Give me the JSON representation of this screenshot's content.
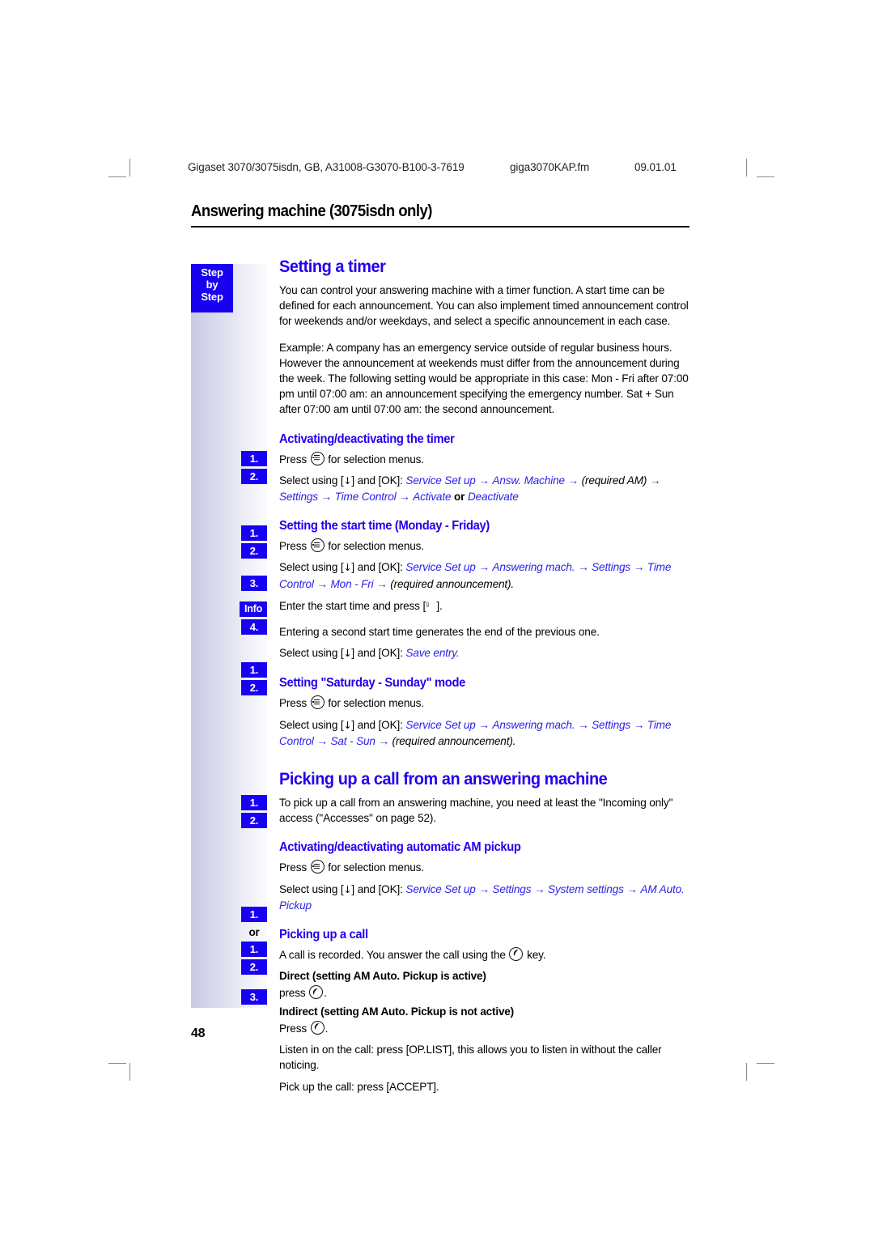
{
  "running_header": {
    "document": "Gigaset 3070/3075isdn, GB, A31008-G3070-B100-3-7619",
    "filename": "giga3070KAP.fm",
    "date": "09.01.01"
  },
  "chapter_title": "Answering machine (3075isdn only)",
  "sidebar": {
    "step_by_step": "Step\nby\nStep",
    "step_by_step_lines": [
      "Step",
      "by",
      "Step"
    ]
  },
  "badges": {
    "one": "1.",
    "two": "2.",
    "three": "3.",
    "four": "4.",
    "info": "Info",
    "or": "or"
  },
  "sections": {
    "setting_a_timer": {
      "heading": "Setting a timer",
      "paragraph_1": "You can control your answering machine with a timer function. A start time can be defined for each announcement. You can also implement timed announcement control for weekends and/or weekdays, and select a specific announcement in each case.",
      "paragraph_2": "Example: A company has an emergency service outside of regular business hours. However the announcement at weekends must differ from the announcement during the week. The following setting would be appropriate in this case: Mon - Fri after 07:00 pm until 07:00 am: an announcement specifying the emergency number. Sat + Sun after 07:00 am until 07:00 am: the second announcement."
    },
    "activating_timer": {
      "heading": "Activating/deactivating the timer",
      "step1_pre": "Press",
      "step1_post": "for selection menus.",
      "step2_pre": "Select using [",
      "step2_mid": "] and [OK]:",
      "step2_path_1": "Service Set up",
      "step2_path_2": "Answ. Machine",
      "step2_path_3": "(required AM)",
      "step2_path_4": "Settings",
      "step2_path_5": "Time Control",
      "step2_path_6": "Activate",
      "step2_or": "or",
      "step2_path_7": "Deactivate"
    },
    "start_time_monfri": {
      "heading": "Setting the start time (Monday - Friday)",
      "step1_pre": "Press",
      "step1_post": "for selection menus.",
      "step2_pre": "Select using [",
      "step2_mid": "] and [OK]:",
      "step2_path_1": "Service Set up",
      "step2_path_2": "Answering mach.",
      "step2_path_3": "Settings",
      "step2_path_4": "Time Control",
      "step2_path_5": "Mon - Fri",
      "step2_path_6": "(required announcement).",
      "step3_pre": "Enter the start time and press [",
      "step3_key": "9",
      "step3_post": "].",
      "info_text": "Entering a second start time generates the end of the previous one.",
      "step4_pre": "Select using [",
      "step4_mid": "] and [OK]:",
      "step4_path": "Save entry."
    },
    "saturday_sunday": {
      "heading": "Setting \"Saturday - Sunday\" mode",
      "step1_pre": "Press",
      "step1_post": "for selection menus.",
      "step2_pre": "Select using [",
      "step2_mid": "] and [OK]:",
      "step2_path_1": "Service Set up",
      "step2_path_2": "Answering mach.",
      "step2_path_3": "Settings",
      "step2_path_4": "Time Control",
      "step2_path_5": "Sat - Sun",
      "step2_path_6": "(required announcement)."
    },
    "picking_up_call": {
      "heading": "Picking up a call from an answering machine",
      "paragraph": "To pick up a call from an answering machine, you need at least the \"Incoming only\" access (\"Accesses\" on page 52)."
    },
    "auto_am_pickup": {
      "heading": "Activating/deactivating automatic AM pickup",
      "step1_pre": "Press",
      "step1_post": "for selection menus.",
      "step2_pre": "Select using [",
      "step2_mid": "] and [OK]:",
      "step2_path_1": "Service Set up",
      "step2_path_2": "Settings",
      "step2_path_3": "System settings",
      "step2_path_4": "AM Auto. Pickup"
    },
    "picking_up_a_call": {
      "heading": "Picking up a call",
      "intro_pre": "A call is recorded. You answer the call using the",
      "intro_post": "key.",
      "direct_heading": "Direct (setting AM Auto. Pickup is active)",
      "direct_step1_pre": "press",
      "direct_step1_post": ".",
      "indirect_heading": "Indirect (setting AM Auto. Pickup is not active)",
      "indirect_step1_pre": "Press",
      "indirect_step1_post": ".",
      "indirect_step2": "Listen in on the call: press [OP.LIST], this allows you to listen in without the caller noticing.",
      "indirect_step3": "Pick up the call: press [ACCEPT]."
    }
  },
  "page_number": "48",
  "icons": {
    "menu_key": "menu-key-icon",
    "phone_key": "phone-key-icon",
    "down_arrow": "▼"
  },
  "colors": {
    "heading_blue": "#2200ee",
    "badge_blue": "#1800f0",
    "menu_path_blue": "#2b22e8"
  }
}
